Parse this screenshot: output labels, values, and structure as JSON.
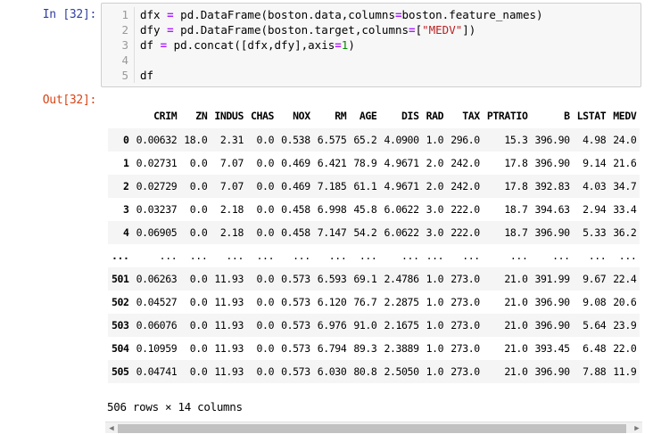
{
  "input_prompt": "In [32]:",
  "output_prompt": "Out[32]:",
  "code_lines": [
    {
      "num": "1",
      "parts": [
        [
          "dfx "
        ],
        [
          "=",
          "op"
        ],
        [
          " pd.DataFrame(boston.data,columns"
        ],
        [
          "=",
          "op"
        ],
        [
          "boston.feature_names)"
        ]
      ]
    },
    {
      "num": "2",
      "parts": [
        [
          "dfy "
        ],
        [
          "=",
          "op"
        ],
        [
          " pd.DataFrame(boston.target,columns"
        ],
        [
          "=",
          "op"
        ],
        [
          "["
        ],
        [
          "\"MEDV\"",
          "str"
        ],
        [
          "])"
        ]
      ]
    },
    {
      "num": "3",
      "parts": [
        [
          "df "
        ],
        [
          "=",
          "op"
        ],
        [
          " pd.concat([dfx,dfy],axis"
        ],
        [
          "=",
          "op"
        ],
        [
          "1",
          "num"
        ],
        [
          ")"
        ]
      ]
    },
    {
      "num": "4",
      "parts": []
    },
    {
      "num": "5",
      "parts": [
        [
          "df"
        ]
      ]
    }
  ],
  "table": {
    "columns": [
      "",
      "CRIM",
      "ZN",
      "INDUS",
      "CHAS",
      "NOX",
      "RM",
      "AGE",
      "DIS",
      "RAD",
      "TAX",
      "PTRATIO",
      "B",
      "LSTAT",
      "MEDV"
    ],
    "rows": [
      [
        "0",
        "0.00632",
        "18.0",
        "2.31",
        "0.0",
        "0.538",
        "6.575",
        "65.2",
        "4.0900",
        "1.0",
        "296.0",
        "15.3",
        "396.90",
        "4.98",
        "24.0"
      ],
      [
        "1",
        "0.02731",
        "0.0",
        "7.07",
        "0.0",
        "0.469",
        "6.421",
        "78.9",
        "4.9671",
        "2.0",
        "242.0",
        "17.8",
        "396.90",
        "9.14",
        "21.6"
      ],
      [
        "2",
        "0.02729",
        "0.0",
        "7.07",
        "0.0",
        "0.469",
        "7.185",
        "61.1",
        "4.9671",
        "2.0",
        "242.0",
        "17.8",
        "392.83",
        "4.03",
        "34.7"
      ],
      [
        "3",
        "0.03237",
        "0.0",
        "2.18",
        "0.0",
        "0.458",
        "6.998",
        "45.8",
        "6.0622",
        "3.0",
        "222.0",
        "18.7",
        "394.63",
        "2.94",
        "33.4"
      ],
      [
        "4",
        "0.06905",
        "0.0",
        "2.18",
        "0.0",
        "0.458",
        "7.147",
        "54.2",
        "6.0622",
        "3.0",
        "222.0",
        "18.7",
        "396.90",
        "5.33",
        "36.2"
      ],
      [
        "...",
        "...",
        "...",
        "...",
        "...",
        "...",
        "...",
        "...",
        "...",
        "...",
        "...",
        "...",
        "...",
        "...",
        "..."
      ],
      [
        "501",
        "0.06263",
        "0.0",
        "11.93",
        "0.0",
        "0.573",
        "6.593",
        "69.1",
        "2.4786",
        "1.0",
        "273.0",
        "21.0",
        "391.99",
        "9.67",
        "22.4"
      ],
      [
        "502",
        "0.04527",
        "0.0",
        "11.93",
        "0.0",
        "0.573",
        "6.120",
        "76.7",
        "2.2875",
        "1.0",
        "273.0",
        "21.0",
        "396.90",
        "9.08",
        "20.6"
      ],
      [
        "503",
        "0.06076",
        "0.0",
        "11.93",
        "0.0",
        "0.573",
        "6.976",
        "91.0",
        "2.1675",
        "1.0",
        "273.0",
        "21.0",
        "396.90",
        "5.64",
        "23.9"
      ],
      [
        "504",
        "0.10959",
        "0.0",
        "11.93",
        "0.0",
        "0.573",
        "6.794",
        "89.3",
        "2.3889",
        "1.0",
        "273.0",
        "21.0",
        "393.45",
        "6.48",
        "22.0"
      ],
      [
        "505",
        "0.04741",
        "0.0",
        "11.93",
        "0.0",
        "0.573",
        "6.030",
        "80.8",
        "2.5050",
        "1.0",
        "273.0",
        "21.0",
        "396.90",
        "7.88",
        "11.9"
      ]
    ]
  },
  "summary": "506 rows × 14 columns",
  "scrollbar": {
    "left_arrow": "◀",
    "right_arrow": "▶"
  }
}
